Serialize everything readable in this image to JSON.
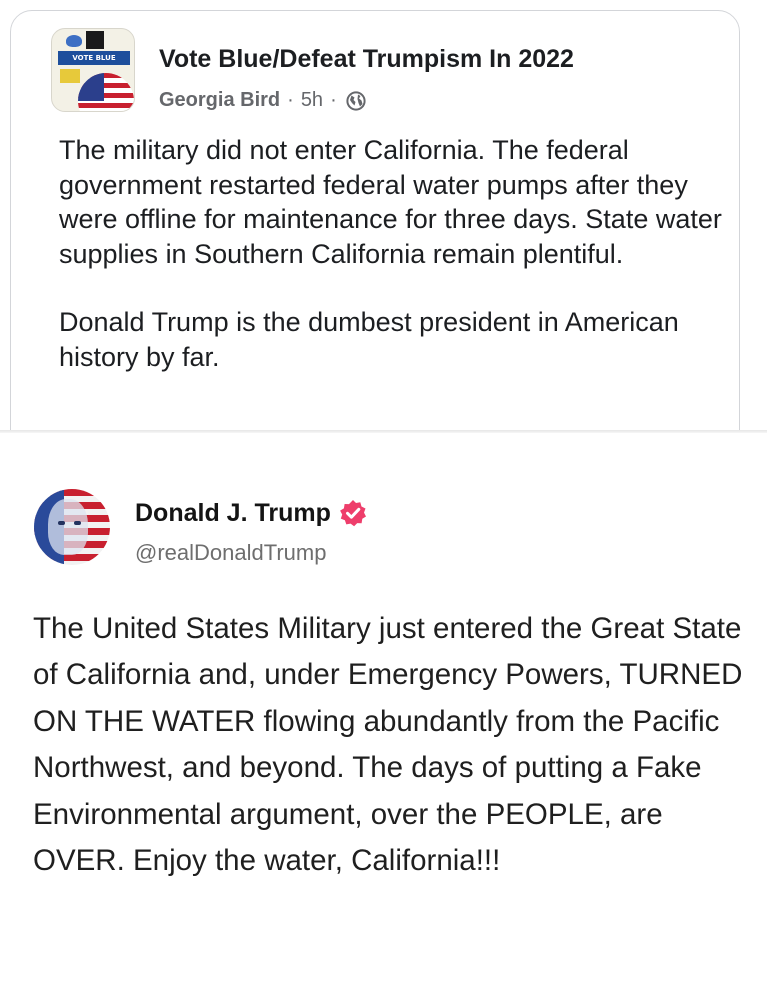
{
  "facebook_post": {
    "group_name": "Vote Blue/Defeat Trumpism In 2022",
    "author": "Georgia Bird",
    "time": "5h",
    "separator": "·",
    "privacy_icon": "globe-icon",
    "avatar_banner_text": "VOTE BLUE",
    "paragraphs": [
      "The military did not enter California. The federal government restarted federal water pumps after they were offline for maintenance for three days. State water supplies in Southern California remain plentiful.",
      "Donald Trump is the dumbest president in American history by far."
    ]
  },
  "quoted_post": {
    "display_name": "Donald J. Trump",
    "handle": "@realDonaldTrump",
    "verified_icon": "verified-badge-icon",
    "verified_color": "#ee3e6b",
    "text": "The United States Military just entered the Great State of California and, under Emergency Powers, TURNED ON THE WATER flowing abundantly from the Pacific Northwest, and beyond. The days of putting a Fake Environmental argument, over the PEOPLE, are OVER. Enjoy the water, California!!!"
  },
  "colors": {
    "meta_gray": "#65676b",
    "card_border": "#d3d5d9",
    "handle_gray": "#6e6e6e"
  }
}
